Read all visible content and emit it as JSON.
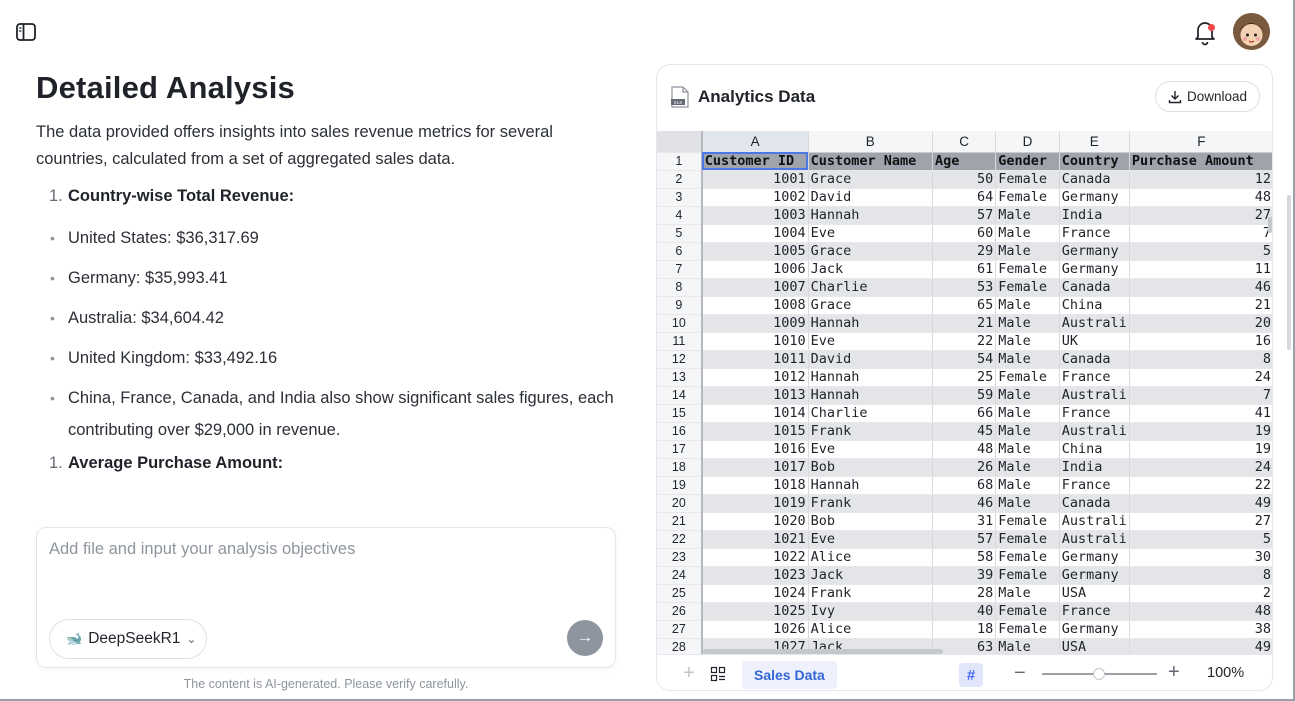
{
  "left": {
    "title": "Detailed Analysis",
    "intro": "The data provided offers insights into sales revenue metrics for several countries, calculated from a set of aggregated sales data.",
    "section1": {
      "num": "1.",
      "label": "Country-wise Total Revenue:"
    },
    "bullets": [
      "United States: $36,317.69",
      "Germany: $35,993.41",
      "Australia: $34,604.42",
      "United Kingdom: $33,492.16",
      "China, France, Canada, and India also show significant sales figures, each contributing over $29,000 in revenue."
    ],
    "section2": {
      "num": "1.",
      "label": "Average Purchase Amount:"
    }
  },
  "input": {
    "placeholder": "Add file and input your analysis objectives",
    "model": "DeepSeekR1"
  },
  "disclaimer": "The content is AI-generated. Please verify carefully.",
  "panel": {
    "title": "Analytics Data",
    "download_label": "Download",
    "file_icon_label": "XLS",
    "columns": [
      "A",
      "B",
      "C",
      "D",
      "E",
      "F"
    ],
    "header_row": [
      "Customer ID",
      "Customer Name",
      "Age",
      "Gender",
      "Country",
      "Purchase Amount"
    ],
    "rows": [
      [
        "1001",
        "Grace",
        "50",
        "Female",
        "Canada",
        "12"
      ],
      [
        "1002",
        "David",
        "64",
        "Female",
        "Germany",
        "48"
      ],
      [
        "1003",
        "Hannah",
        "57",
        "Male",
        "India",
        "27"
      ],
      [
        "1004",
        "Eve",
        "60",
        "Male",
        "France",
        "7"
      ],
      [
        "1005",
        "Grace",
        "29",
        "Male",
        "Germany",
        "5"
      ],
      [
        "1006",
        "Jack",
        "61",
        "Female",
        "Germany",
        "11"
      ],
      [
        "1007",
        "Charlie",
        "53",
        "Female",
        "Canada",
        "46"
      ],
      [
        "1008",
        "Grace",
        "65",
        "Male",
        "China",
        "21"
      ],
      [
        "1009",
        "Hannah",
        "21",
        "Male",
        "Australi",
        "20"
      ],
      [
        "1010",
        "Eve",
        "22",
        "Male",
        "UK",
        "16"
      ],
      [
        "1011",
        "David",
        "54",
        "Male",
        "Canada",
        "8"
      ],
      [
        "1012",
        "Hannah",
        "25",
        "Female",
        "France",
        "24"
      ],
      [
        "1013",
        "Hannah",
        "59",
        "Male",
        "Australi",
        "7"
      ],
      [
        "1014",
        "Charlie",
        "66",
        "Male",
        "France",
        "41"
      ],
      [
        "1015",
        "Frank",
        "45",
        "Male",
        "Australi",
        "19"
      ],
      [
        "1016",
        "Eve",
        "48",
        "Male",
        "China",
        "19"
      ],
      [
        "1017",
        "Bob",
        "26",
        "Male",
        "India",
        "24"
      ],
      [
        "1018",
        "Hannah",
        "68",
        "Male",
        "France",
        "22"
      ],
      [
        "1019",
        "Frank",
        "46",
        "Male",
        "Canada",
        "49"
      ],
      [
        "1020",
        "Bob",
        "31",
        "Female",
        "Australi",
        "27"
      ],
      [
        "1021",
        "Eve",
        "57",
        "Female",
        "Australi",
        "5"
      ],
      [
        "1022",
        "Alice",
        "58",
        "Female",
        "Germany",
        "30"
      ],
      [
        "1023",
        "Jack",
        "39",
        "Female",
        "Germany",
        "8"
      ],
      [
        "1024",
        "Frank",
        "28",
        "Male",
        "USA",
        "2"
      ],
      [
        "1025",
        "Ivy",
        "40",
        "Female",
        "France",
        "48"
      ],
      [
        "1026",
        "Alice",
        "18",
        "Female",
        "Germany",
        "38"
      ],
      [
        "1027",
        "Jack",
        "63",
        "Male",
        "USA",
        "49"
      ]
    ],
    "sheet_tab": "Sales Data",
    "zoom": "100%"
  }
}
